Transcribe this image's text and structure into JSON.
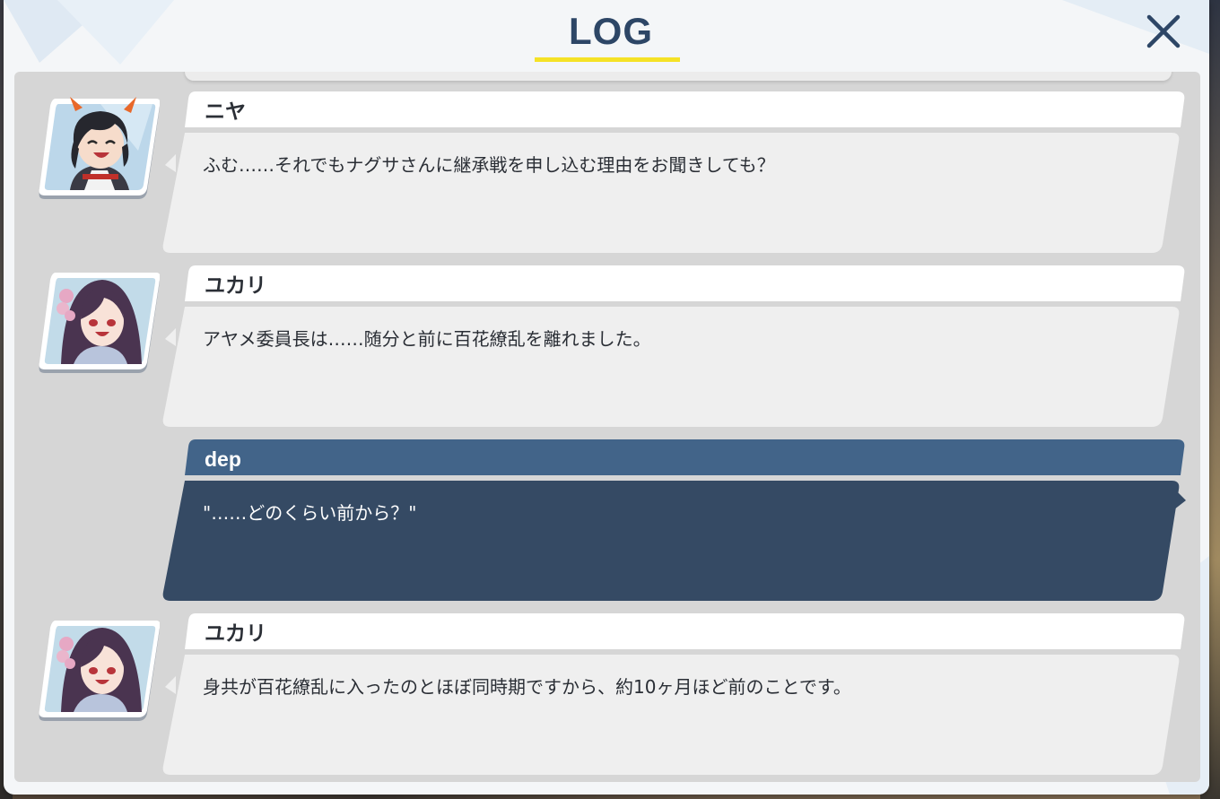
{
  "header": {
    "title": "LOG",
    "close_icon": "close-icon",
    "accent_color": "#f5e226",
    "title_color": "#2d4666"
  },
  "log": {
    "entries": [
      {
        "speaker": "ニヤ",
        "message": "ふむ……それでもナグサさんに継承戦を申し込む理由をお聞きしても？",
        "avatar": "niya-portrait",
        "type": "npc"
      },
      {
        "speaker": "ユカリ",
        "message": "アヤメ委員長は……随分と前に百花繚乱を離れました。",
        "avatar": "yukari-portrait",
        "type": "npc"
      },
      {
        "speaker": "dep",
        "message": "\"……どのくらい前から？\"",
        "type": "player"
      },
      {
        "speaker": "ユカリ",
        "message": "身共が百花繚乱に入ったのとほぼ同時期ですから、約10ヶ月ほど前のことです。",
        "avatar": "yukari-portrait",
        "type": "npc"
      }
    ]
  },
  "colors": {
    "npc_bubble_header": "#ffffff",
    "npc_bubble_body": "#efefef",
    "player_bubble_header": "#426489",
    "player_bubble_body": "#354a64",
    "log_background": "#d6d6d6"
  }
}
